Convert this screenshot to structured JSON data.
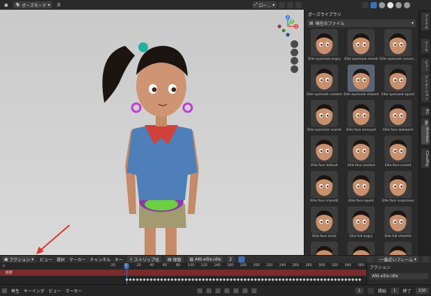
{
  "viewport": {
    "mode_label": "ポーズモード",
    "orientation_label": "ロー...",
    "gizmo": {
      "z": "Z",
      "y": "Y",
      "x": "X"
    }
  },
  "asset_library": {
    "title": "ポーズライブラリ",
    "dropdown_label": "現在のファイル",
    "assets": [
      "Ellie eyemask angry",
      "Ellie eyemask closed",
      "Ellie eyemask concer...",
      "Ellie eyemask content",
      "Ellie eyemask relaxed",
      "Ellie eyemask squint",
      "Ellie eyemask scared",
      "Ellie face annoyed",
      "Ellie face awkward",
      "Ellie face default",
      "Ellie face excited",
      "Ellie face scared",
      "Ellie face scared2",
      "Ellie face squint",
      "Ellie face suspicious",
      "Ellie face smile",
      "Ellie full angry",
      "Ellie full cheerful",
      "",
      "",
      ""
    ],
    "selected_index": 4
  },
  "sidebar_tabs": [
    "アイテム",
    "ツール",
    "ビュー",
    "アニメーション",
    "BG",
    "編集",
    "Animbox",
    "CloudRig"
  ],
  "dopesheet": {
    "editor_mode": "アクション",
    "menus": [
      "ビュー",
      "選択",
      "マーカー",
      "チャンネル",
      "キー"
    ],
    "push_down_label": "ストリップ化",
    "stash_label": "保留",
    "action_name": "ANI-ellie.idle",
    "user_count": "2",
    "snap_label": "一番近いフレーム",
    "summary_label": "概要",
    "current_frame_marker": "1",
    "ruler_ticks": [
      "-20",
      "0",
      "20",
      "40",
      "60",
      "80",
      "100",
      "120",
      "140",
      "160",
      "180",
      "200",
      "220",
      "240",
      "260",
      "280",
      "300",
      "320",
      "340",
      "360"
    ],
    "side_panel": {
      "heading": "アクション",
      "action": "ANI-ellie.idle"
    }
  },
  "playback": {
    "menus": [
      "再生",
      "キーイング",
      "ビュー",
      "マーカー"
    ],
    "current_frame": "1",
    "start_label": "開始",
    "start_value": "1",
    "end_label": "終了",
    "end_value": "330"
  },
  "colors": {
    "accent_blue": "#4772b3",
    "summary_red": "#7a2b2b",
    "annotation_arrow": "#e0352b"
  }
}
